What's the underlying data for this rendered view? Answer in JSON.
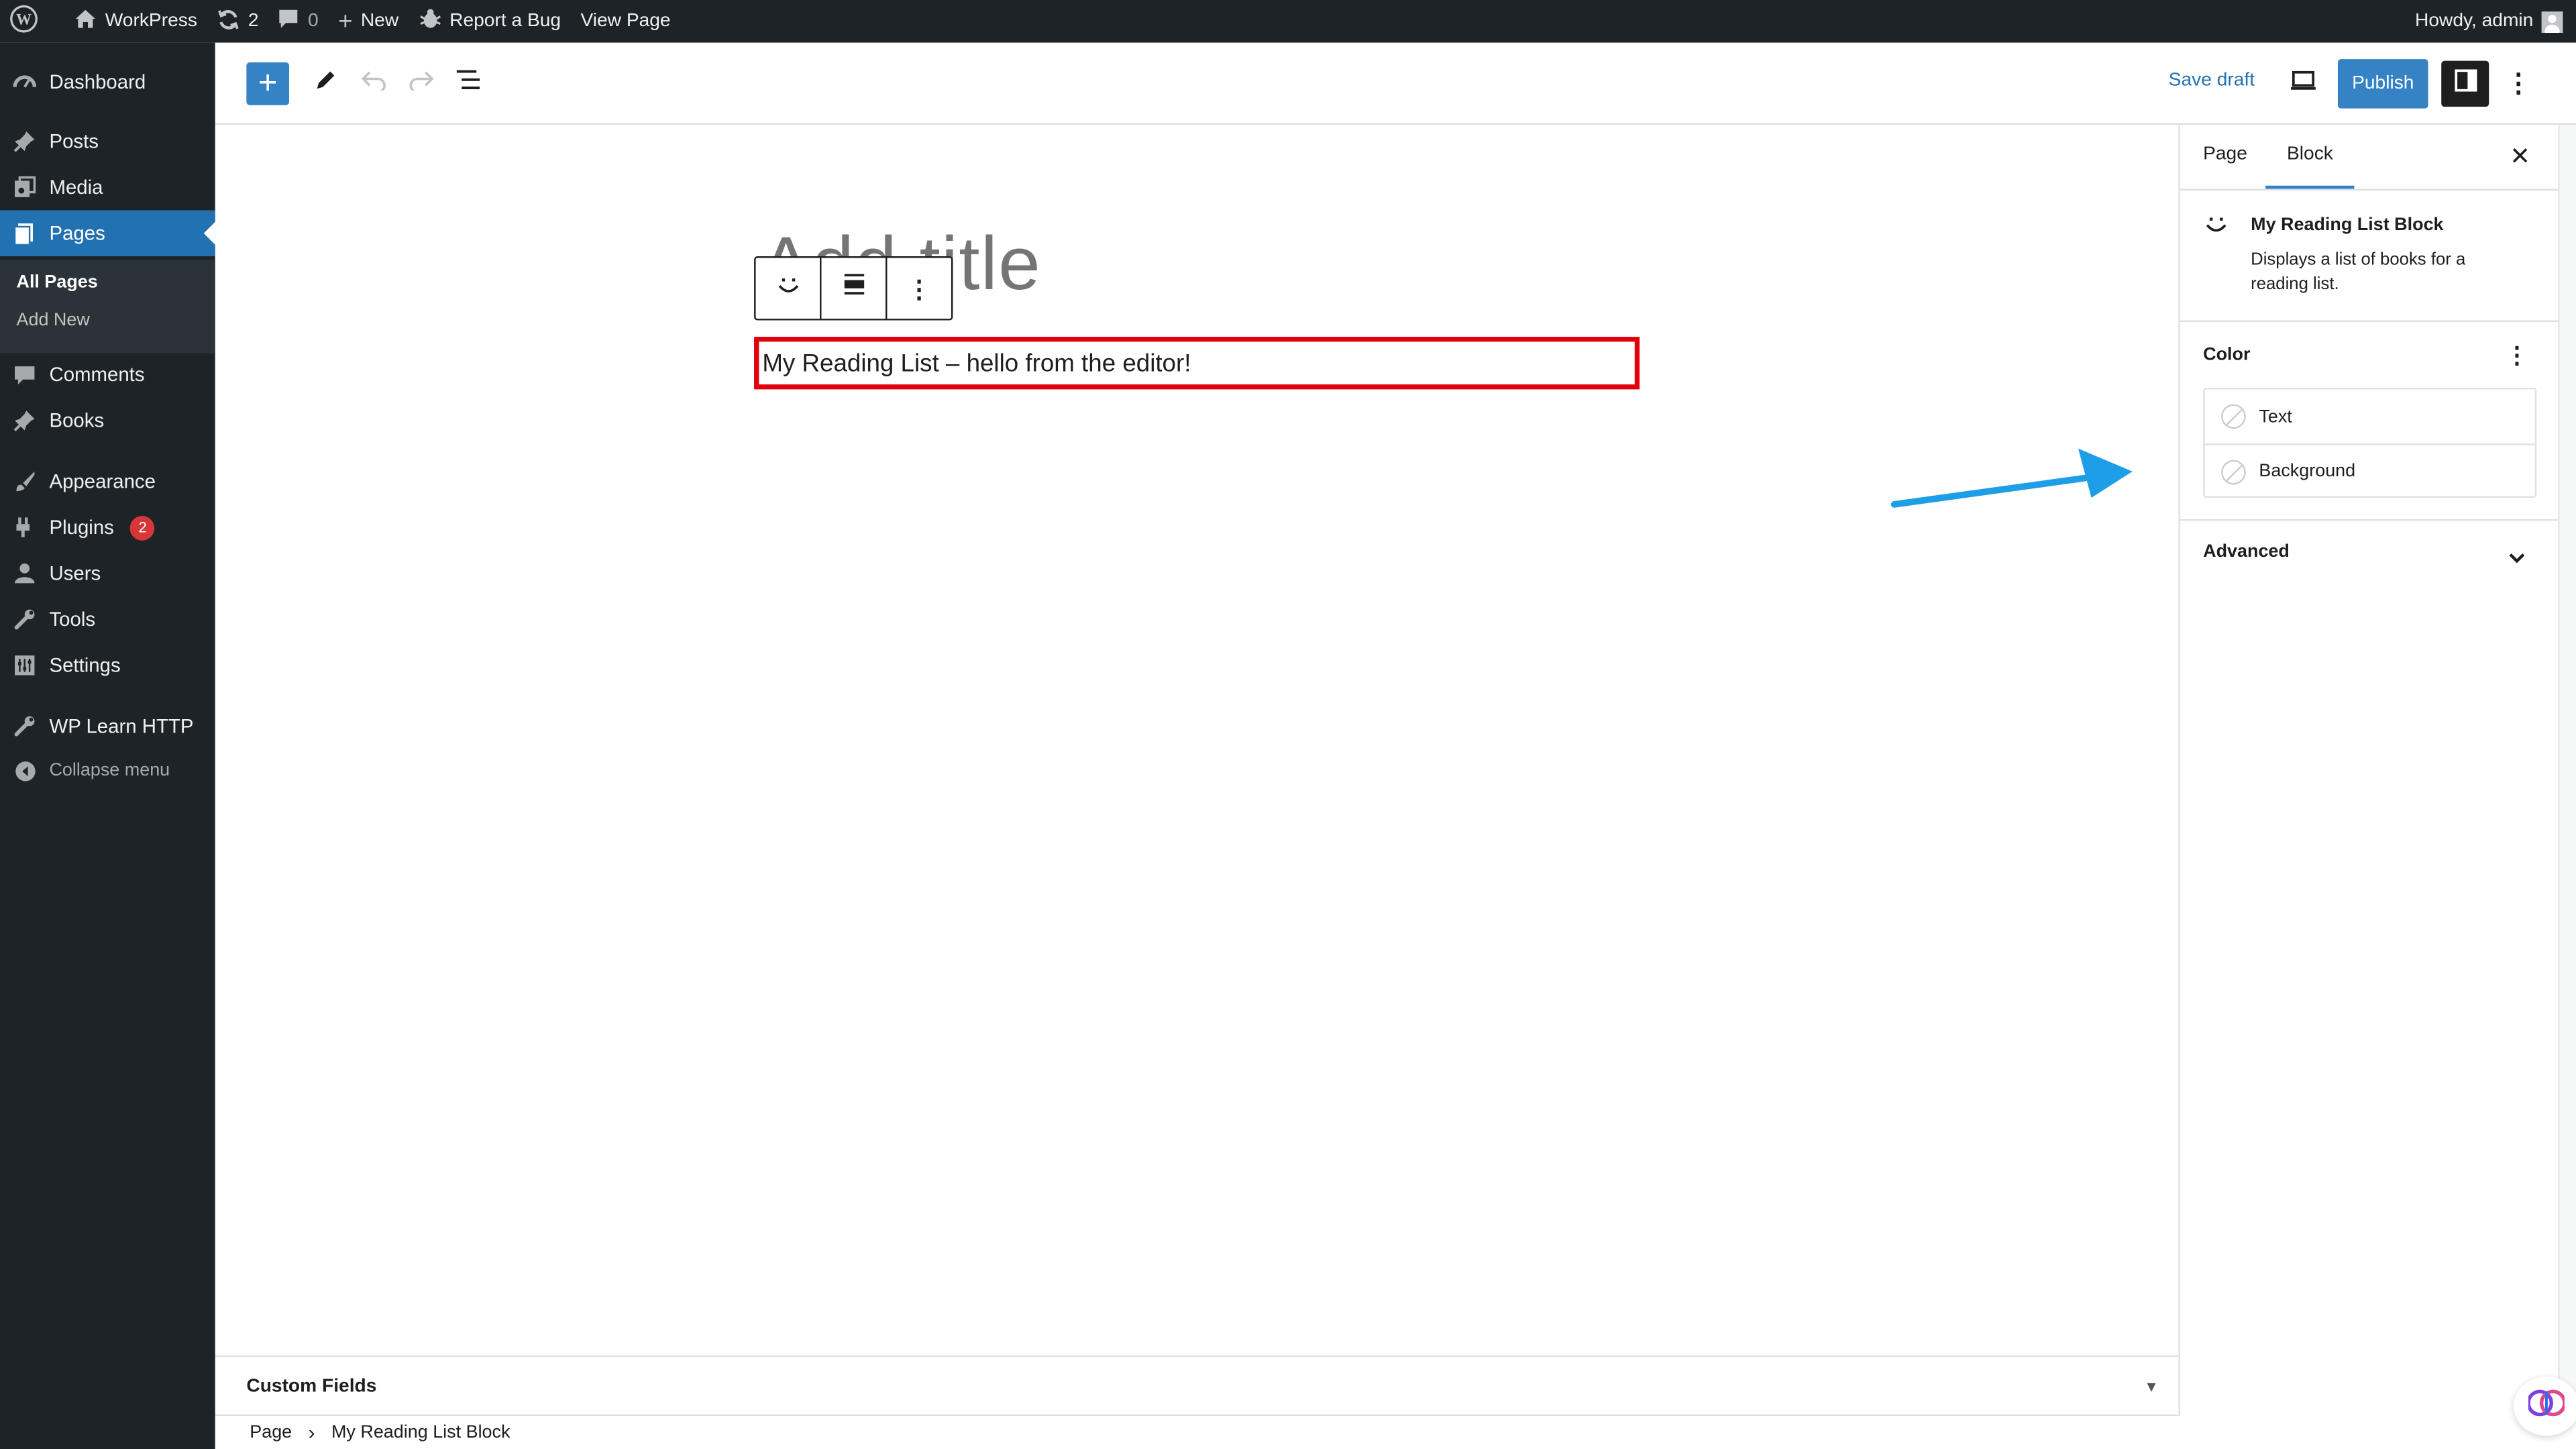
{
  "admin_bar": {
    "site_name": "WorkPress",
    "updates_count": "2",
    "comments_count": "0",
    "new_label": "New",
    "report_bug_label": "Report a Bug",
    "view_page_label": "View Page",
    "howdy": "Howdy, admin"
  },
  "sidebar": {
    "items": [
      {
        "label": "Dashboard",
        "icon": "dashboard-icon"
      },
      {
        "label": "Posts",
        "icon": "pin-icon"
      },
      {
        "label": "Media",
        "icon": "media-icon"
      },
      {
        "label": "Pages",
        "icon": "pages-icon",
        "active": true
      },
      {
        "label": "Comments",
        "icon": "comment-icon"
      },
      {
        "label": "Books",
        "icon": "pin-icon"
      },
      {
        "label": "Appearance",
        "icon": "brush-icon"
      },
      {
        "label": "Plugins",
        "icon": "plugin-icon",
        "badge": "2"
      },
      {
        "label": "Users",
        "icon": "user-icon"
      },
      {
        "label": "Tools",
        "icon": "wrench-icon"
      },
      {
        "label": "Settings",
        "icon": "settings-icon"
      },
      {
        "label": "WP Learn HTTP",
        "icon": "wrench-icon"
      }
    ],
    "submenu": [
      "All Pages",
      "Add New"
    ],
    "collapse_label": "Collapse menu"
  },
  "editor_header": {
    "save_draft": "Save draft",
    "publish": "Publish"
  },
  "canvas": {
    "title_placeholder": "Add title",
    "block_text": "My Reading List – hello from the editor!"
  },
  "settings_sidebar": {
    "tabs": [
      "Page",
      "Block"
    ],
    "active_tab": "Block",
    "block_card": {
      "title": "My Reading List Block",
      "description": "Displays a list of books for a reading list."
    },
    "color_panel": {
      "title": "Color",
      "options": [
        "Text",
        "Background"
      ]
    },
    "advanced_panel": {
      "title": "Advanced"
    }
  },
  "meta_boxes": {
    "custom_fields": "Custom Fields"
  },
  "breadcrumb": [
    "Page",
    "My Reading List Block"
  ],
  "colors": {
    "admin_dark": "#1d2327",
    "accent_blue": "#3582c4",
    "active_menu": "#2271b1",
    "block_outline": "#e0010b",
    "annotation_arrow": "#1e9ee6",
    "badge_red": "#d63638"
  }
}
